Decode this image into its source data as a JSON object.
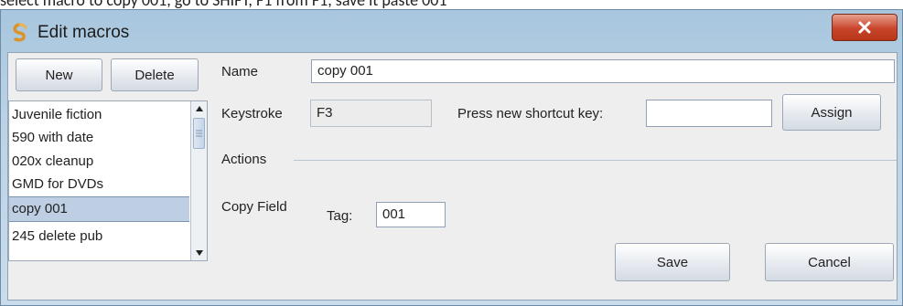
{
  "doc_snippet": "select macro to copy 001, go to SHIFT, F1 from F1, save it  paste 001",
  "window": {
    "title": "Edit macros",
    "close_symbol": "X"
  },
  "list_panel": {
    "new_label": "New",
    "delete_label": "Delete",
    "items": [
      {
        "label": "Juvenile fiction",
        "selected": false
      },
      {
        "label": "590 with date",
        "selected": false
      },
      {
        "label": "020x cleanup",
        "selected": false
      },
      {
        "label": "GMD for DVDs",
        "selected": false
      },
      {
        "label": "copy 001",
        "selected": true
      },
      {
        "label": "245 delete pub",
        "selected": false
      }
    ]
  },
  "form": {
    "name_label": "Name",
    "name_value": "copy 001",
    "keystroke_label": "Keystroke",
    "keystroke_value": "F3",
    "shortcut_label": "Press new shortcut key:",
    "shortcut_value": "",
    "assign_label": "Assign",
    "actions_label": "Actions",
    "copy_field_label": "Copy Field",
    "tag_label": "Tag:",
    "tag_value": "001"
  },
  "footer": {
    "save_label": "Save",
    "cancel_label": "Cancel"
  },
  "colors": {
    "titlebar": "#bcd3e6",
    "close_button": "#c8452c",
    "selection": "#bfcfe3"
  }
}
